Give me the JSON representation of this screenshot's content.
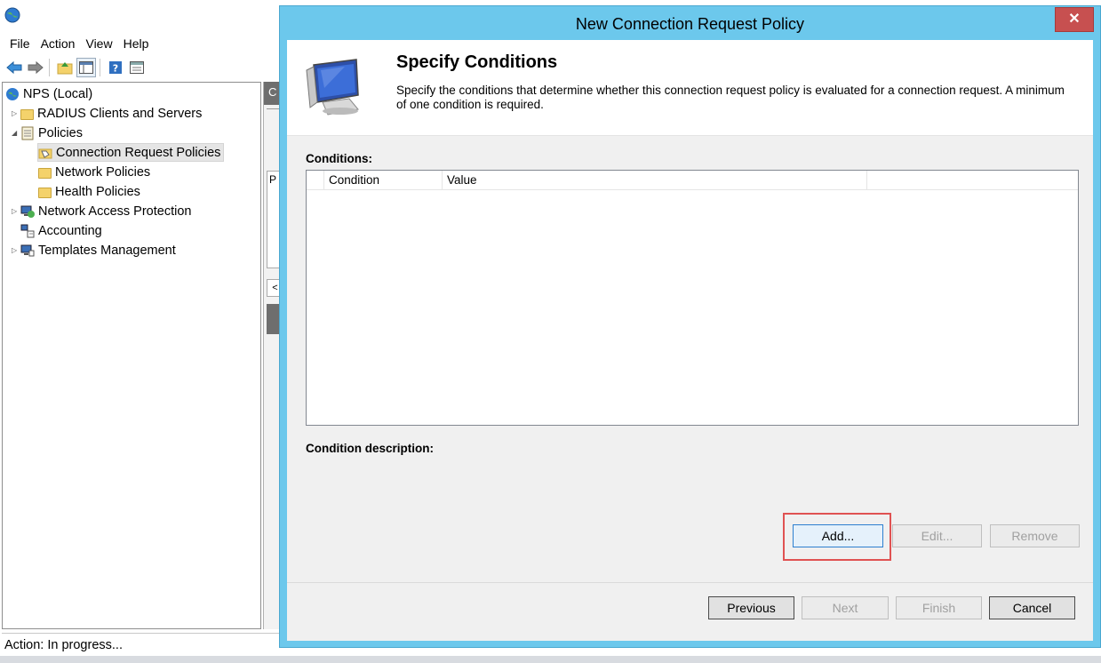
{
  "menu": [
    "File",
    "Action",
    "View",
    "Help"
  ],
  "tree": {
    "root": "NPS (Local)",
    "items": [
      {
        "label": "RADIUS Clients and Servers"
      },
      {
        "label": "Policies"
      },
      {
        "label": "Connection Request Policies"
      },
      {
        "label": "Network Policies"
      },
      {
        "label": "Health Policies"
      },
      {
        "label": "Network Access Protection"
      },
      {
        "label": "Accounting"
      },
      {
        "label": "Templates Management"
      }
    ]
  },
  "right_pane": {
    "header_char": "C",
    "col_char": "P"
  },
  "status": "Action:  In progress...",
  "dialog": {
    "title": "New Connection Request Policy",
    "close": "✕",
    "header_title": "Specify Conditions",
    "header_desc": "Specify the conditions that determine whether this connection request policy is evaluated for a connection request. A minimum of one condition is required.",
    "conditions_label": "Conditions:",
    "columns": [
      "Condition",
      "Value"
    ],
    "condition_description_label": "Condition description:",
    "buttons": {
      "add": "Add...",
      "edit": "Edit...",
      "remove": "Remove",
      "previous": "Previous",
      "next": "Next",
      "finish": "Finish",
      "cancel": "Cancel"
    }
  },
  "colors": {
    "dialog_frame": "#6cc8ec",
    "close_button": "#c75050",
    "highlight": "#e05252"
  }
}
